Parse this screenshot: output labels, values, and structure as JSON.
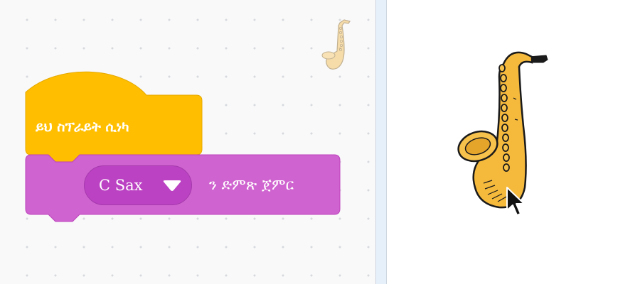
{
  "colors": {
    "events_block": "#ffbf00",
    "events_border": "#e6a800",
    "sound_block": "#cf63cf",
    "sound_border": "#bd42bd",
    "dropdown_fill": "#bb42c3",
    "code_area_bg": "#f9f9f9",
    "stage_bg": "#ffffff",
    "sax_body": "#f5b93c"
  },
  "code_area": {
    "hat_block": {
      "label": "ይህ ስፕራይት ሲነካ"
    },
    "sound_block": {
      "dropdown_value": "C Sax",
      "label": "ን ድምጽ ጀምር"
    }
  },
  "icons": {
    "sprite_thumbnail": "saxophone-icon",
    "stage_sprite": "saxophone-icon",
    "dropdown_arrow": "triangle-down-icon",
    "cursor": "mouse-pointer-icon"
  }
}
